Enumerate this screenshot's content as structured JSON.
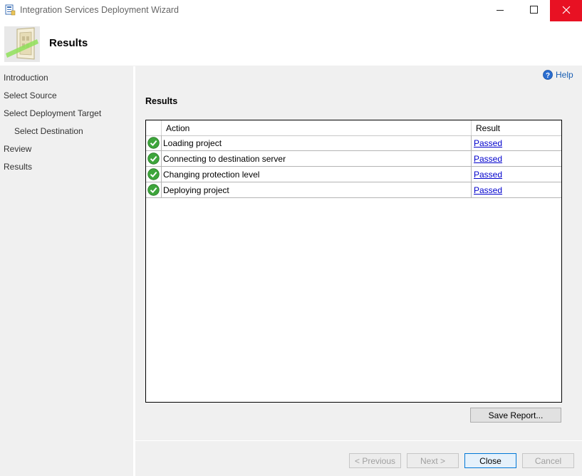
{
  "window": {
    "title": "Integration Services Deployment Wizard",
    "accent_close_color": "#e81123"
  },
  "header": {
    "title": "Results",
    "icon": "wizard-door-icon"
  },
  "sidebar": {
    "items": [
      {
        "label": "Introduction"
      },
      {
        "label": "Select Source"
      },
      {
        "label": "Select Deployment Target"
      },
      {
        "label": "Select Destination"
      },
      {
        "label": "Review"
      },
      {
        "label": "Results"
      }
    ]
  },
  "main": {
    "help_label": "Help",
    "section_title": "Results",
    "columns": {
      "action": "Action",
      "result": "Result"
    },
    "rows": [
      {
        "action": "Loading project",
        "result": "Passed",
        "status_icon": "success-check-icon"
      },
      {
        "action": "Connecting to destination server",
        "result": "Passed",
        "status_icon": "success-check-icon"
      },
      {
        "action": "Changing protection level",
        "result": "Passed",
        "status_icon": "success-check-icon"
      },
      {
        "action": "Deploying project",
        "result": "Passed",
        "status_icon": "success-check-icon"
      }
    ],
    "save_report_label": "Save Report..."
  },
  "footer": {
    "previous_label": "< Previous",
    "next_label": "Next >",
    "close_label": "Close",
    "cancel_label": "Cancel"
  }
}
